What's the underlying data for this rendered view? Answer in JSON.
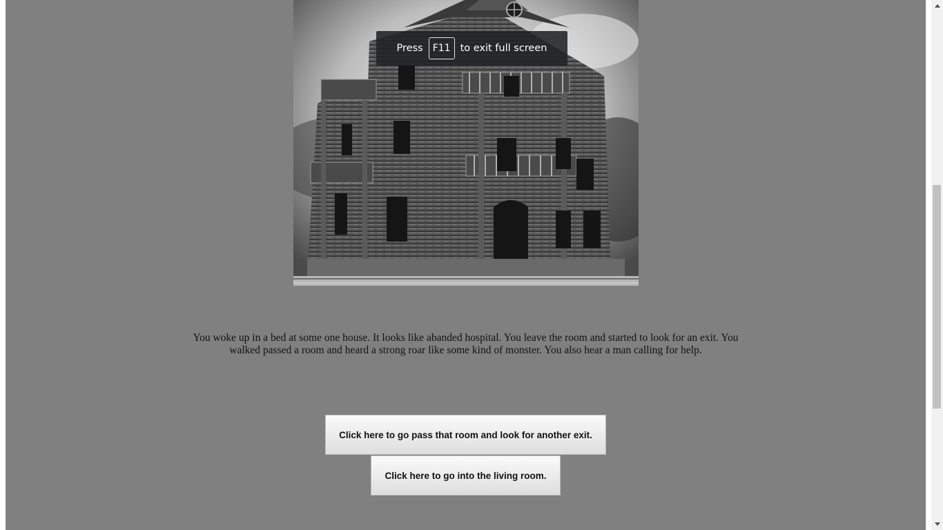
{
  "story": {
    "text": "You woke up in a bed at some one house. It looks like abanded hospital. You leave the room and started to look for an exit. You walked passed a room and heard a strong roar like some kind of monster. You also hear a man calling for help."
  },
  "choices": [
    {
      "label": "Click here to go pass that room and look for another exit."
    },
    {
      "label": "Click here to go into the living room."
    }
  ],
  "fullscreen_notice": {
    "prefix": "Press",
    "key": "F11",
    "suffix": "to exit full screen"
  },
  "colors": {
    "page_background": "#808080",
    "button_background": "#efefef"
  },
  "images": [
    {
      "name": "haunted-house-image",
      "description_icon": "haunted-house"
    }
  ]
}
